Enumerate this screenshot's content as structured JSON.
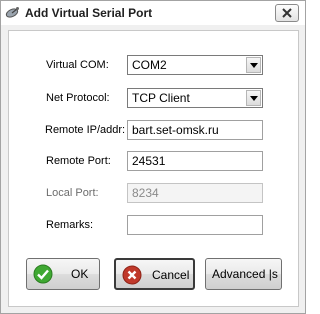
{
  "window": {
    "title": "Add Virtual Serial Port"
  },
  "form": {
    "virtual_com": {
      "label": "Virtual COM:",
      "value": "COM2"
    },
    "net_protocol": {
      "label": "Net Protocol:",
      "value": "TCP Client"
    },
    "remote_ip": {
      "label": "Remote IP/addr:",
      "value": "bart.set-omsk.ru"
    },
    "remote_port": {
      "label": "Remote Port:",
      "value": "24531"
    },
    "local_port": {
      "label": "Local Port:",
      "value": "8234"
    },
    "remarks": {
      "label": "Remarks:",
      "value": ""
    }
  },
  "buttons": {
    "ok": "OK",
    "cancel": "Cancel",
    "advanced": "Advanced |s"
  },
  "colors": {
    "ok_icon": "#3fa832",
    "cancel_icon": "#c0392b"
  },
  "icons": {
    "title": "satellite-dish-icon",
    "close": "close-icon",
    "dropdown": "chevron-down-icon",
    "ok": "check-circle-icon",
    "cancel": "x-circle-icon"
  }
}
